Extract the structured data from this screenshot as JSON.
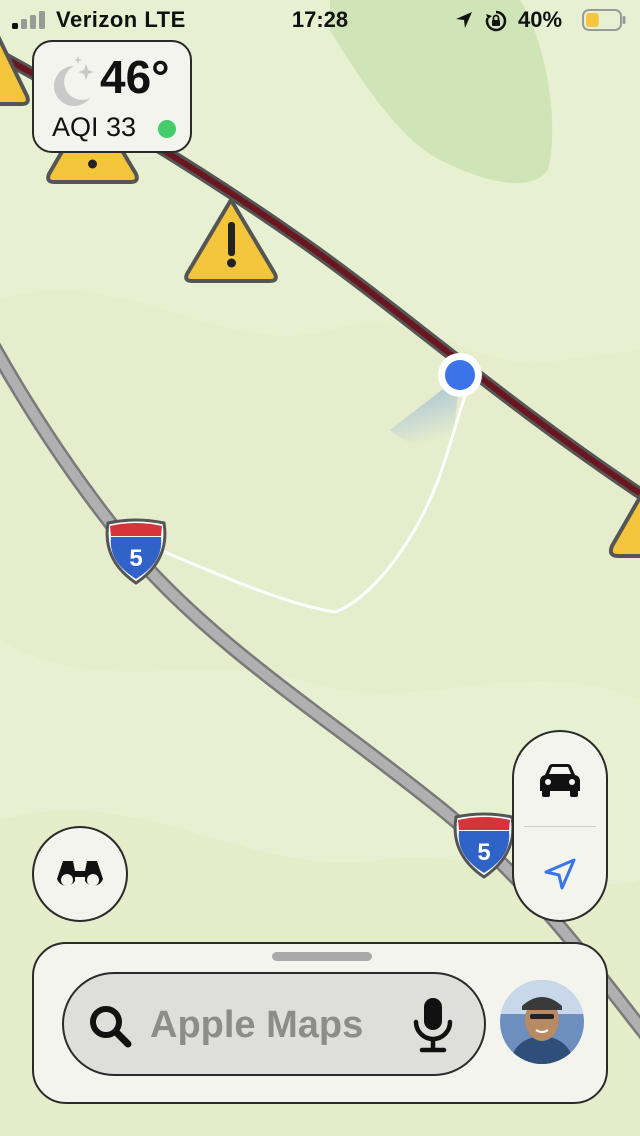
{
  "status_bar": {
    "carrier": "Verizon  LTE",
    "time": "17:28",
    "battery_percent": "40%",
    "signal_bars_filled": 1,
    "signal_bars_total": 4,
    "battery_level": 0.4
  },
  "weather": {
    "icon": "moon-stars-icon",
    "temperature": "46°",
    "aqi_label": "AQI 33",
    "aqi_color": "#44cc6a"
  },
  "map": {
    "highway_shields": [
      "5",
      "5"
    ],
    "hazard_icon": "warning-triangle-icon",
    "route_color": "#6a1620",
    "user_location_color": "#3a74e8"
  },
  "controls": {
    "transport_icon": "car-icon",
    "locate_icon": "location-arrow-icon",
    "look_around_icon": "binoculars-icon"
  },
  "search": {
    "placeholder": "Apple Maps",
    "search_icon": "magnifier-icon",
    "mic_icon": "microphone-icon",
    "avatar_icon": "profile-avatar"
  }
}
